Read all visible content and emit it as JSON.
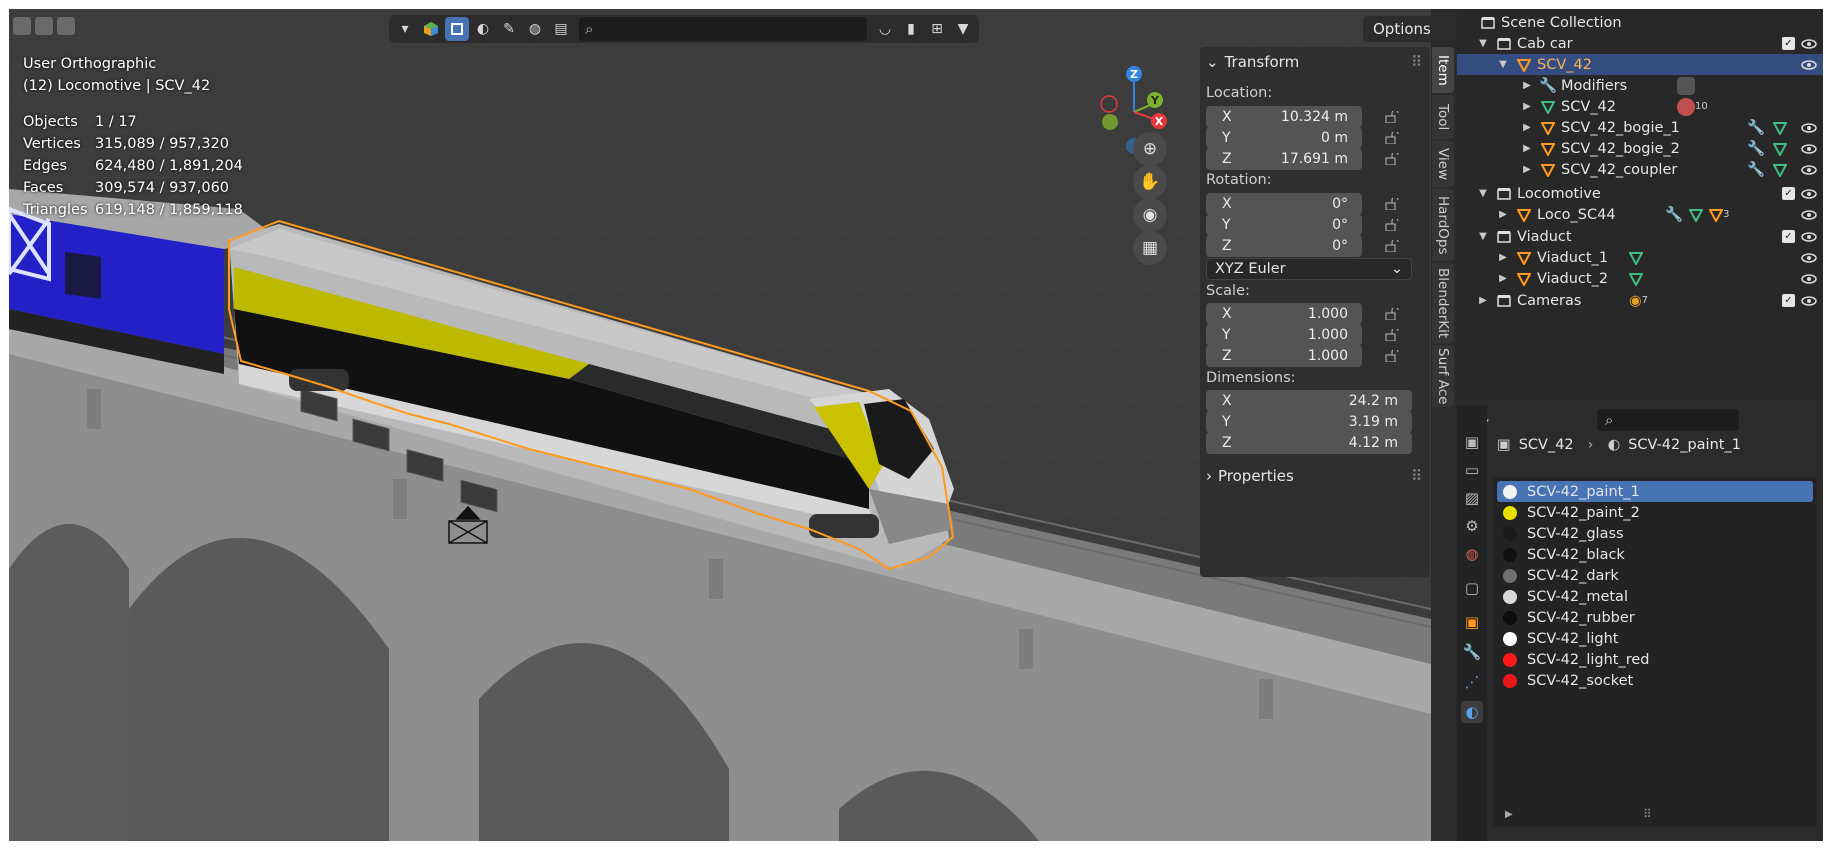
{
  "viewport": {
    "view_name": "User Orthographic",
    "context_line": "(12) Locomotive | SCV_42",
    "stats": [
      {
        "label": "Objects",
        "value": "1 / 17"
      },
      {
        "label": "Vertices",
        "value": "315,089 / 957,320"
      },
      {
        "label": "Edges",
        "value": "624,480 / 1,891,204"
      },
      {
        "label": "Faces",
        "value": "309,574 / 937,060"
      },
      {
        "label": "Triangles",
        "value": "619,148 / 1,859,118"
      }
    ],
    "options_label": "Options",
    "gizmo": {
      "x": "X",
      "y": "Y",
      "z": "Z"
    }
  },
  "npanel": {
    "transform_title": "Transform",
    "location_label": "Location:",
    "location": [
      {
        "axis": "X",
        "value": "10.324 m"
      },
      {
        "axis": "Y",
        "value": "0 m"
      },
      {
        "axis": "Z",
        "value": "17.691 m"
      }
    ],
    "rotation_label": "Rotation:",
    "rotation": [
      {
        "axis": "X",
        "value": "0°"
      },
      {
        "axis": "Y",
        "value": "0°"
      },
      {
        "axis": "Z",
        "value": "0°"
      }
    ],
    "rotation_mode": "XYZ Euler",
    "scale_label": "Scale:",
    "scale": [
      {
        "axis": "X",
        "value": "1.000"
      },
      {
        "axis": "Y",
        "value": "1.000"
      },
      {
        "axis": "Z",
        "value": "1.000"
      }
    ],
    "dimensions_label": "Dimensions:",
    "dimensions": [
      {
        "axis": "X",
        "value": "24.2 m"
      },
      {
        "axis": "Y",
        "value": "3.19 m"
      },
      {
        "axis": "Z",
        "value": "4.12 m"
      }
    ],
    "properties_title": "Properties",
    "tabs": [
      "Item",
      "Tool",
      "View",
      "HardOps",
      "BlenderKit",
      "Surf Ace"
    ]
  },
  "outliner": {
    "root": "Scene Collection",
    "items": [
      {
        "name": "Cab car",
        "type": "collection"
      },
      {
        "name": "SCV_42",
        "type": "object"
      },
      {
        "name": "Modifiers",
        "type": "modifiers"
      },
      {
        "name": "SCV_42",
        "type": "mesh",
        "badge": "10"
      },
      {
        "name": "SCV_42_bogie_1",
        "type": "object"
      },
      {
        "name": "SCV_42_bogie_2",
        "type": "object"
      },
      {
        "name": "SCV_42_coupler",
        "type": "object"
      },
      {
        "name": "Locomotive",
        "type": "collection"
      },
      {
        "name": "Loco_SC44",
        "type": "object",
        "badge": "3"
      },
      {
        "name": "Viaduct",
        "type": "collection"
      },
      {
        "name": "Viaduct_1",
        "type": "object"
      },
      {
        "name": "Viaduct_2",
        "type": "object"
      },
      {
        "name": "Cameras",
        "type": "collection",
        "badge": "7"
      }
    ]
  },
  "properties": {
    "breadcrumb_object": "SCV_42",
    "breadcrumb_material": "SCV-42_paint_1",
    "materials": [
      {
        "name": "SCV-42_paint_1",
        "color": "#f2f2f2"
      },
      {
        "name": "SCV-42_paint_2",
        "color": "#e8e000"
      },
      {
        "name": "SCV-42_glass",
        "color": "#1a1a1a"
      },
      {
        "name": "SCV-42_black",
        "color": "#111111"
      },
      {
        "name": "SCV-42_dark",
        "color": "#707070"
      },
      {
        "name": "SCV-42_metal",
        "color": "#d9d9d9"
      },
      {
        "name": "SCV-42_rubber",
        "color": "#0c0c0c"
      },
      {
        "name": "SCV-42_light",
        "color": "#ffffff"
      },
      {
        "name": "SCV-42_light_red",
        "color": "#ff1a1a"
      },
      {
        "name": "SCV-42_socket",
        "color": "#e81818"
      }
    ]
  },
  "colors": {
    "selection_blue": "#4772b3",
    "outliner_selected": "#334d80",
    "selection_orange": "#ff9a1f",
    "axis_x": "#e8393a",
    "axis_y": "#7bb22d",
    "axis_z": "#2f85e0"
  }
}
